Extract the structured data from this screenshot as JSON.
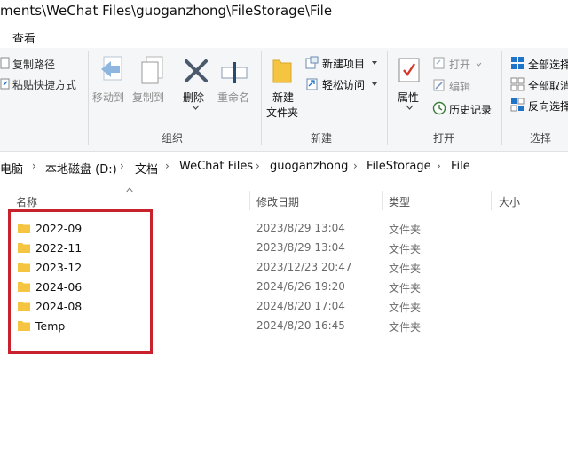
{
  "window": {
    "path_title": "ments\\WeChat Files\\guoganzhong\\FileStorage\\File"
  },
  "ribbon_tabs": {
    "view": "查看"
  },
  "ribbon": {
    "clipboard": {
      "copy_path": "复制路径",
      "paste_shortcut": "粘贴快捷方式"
    },
    "organize": {
      "label": "组织",
      "move_to": "移动到",
      "copy_to": "复制到",
      "delete": "删除",
      "rename": "重命名"
    },
    "new": {
      "label": "新建",
      "new_folder_line1": "新建",
      "new_folder_line2": "文件夹",
      "new_item": "新建项目",
      "easy_access": "轻松访问"
    },
    "open": {
      "label": "打开",
      "properties": "属性",
      "open": "打开",
      "edit": "编辑",
      "history": "历史记录"
    },
    "select": {
      "label": "选择",
      "select_all": "全部选择",
      "select_none": "全部取消",
      "invert": "反向选择"
    }
  },
  "address": {
    "crumbs": [
      "电脑",
      "本地磁盘 (D:)",
      "文档",
      "WeChat Files",
      "guoganzhong",
      "FileStorage",
      "File"
    ]
  },
  "columns": {
    "name": "名称",
    "modified": "修改日期",
    "type": "类型",
    "size": "大小"
  },
  "files": [
    {
      "name": "2022-09",
      "modified": "2023/8/29 13:04",
      "type": "文件夹"
    },
    {
      "name": "2022-11",
      "modified": "2023/8/29 13:04",
      "type": "文件夹"
    },
    {
      "name": "2023-12",
      "modified": "2023/12/23 20:47",
      "type": "文件夹"
    },
    {
      "name": "2024-06",
      "modified": "2024/6/26 19:20",
      "type": "文件夹"
    },
    {
      "name": "2024-08",
      "modified": "2024/8/20 17:04",
      "type": "文件夹"
    },
    {
      "name": "Temp",
      "modified": "2024/8/20 16:45",
      "type": "文件夹"
    }
  ],
  "colors": {
    "highlight": "#c8232c",
    "folder": "#f5c542",
    "accent": "#1e74c8"
  }
}
